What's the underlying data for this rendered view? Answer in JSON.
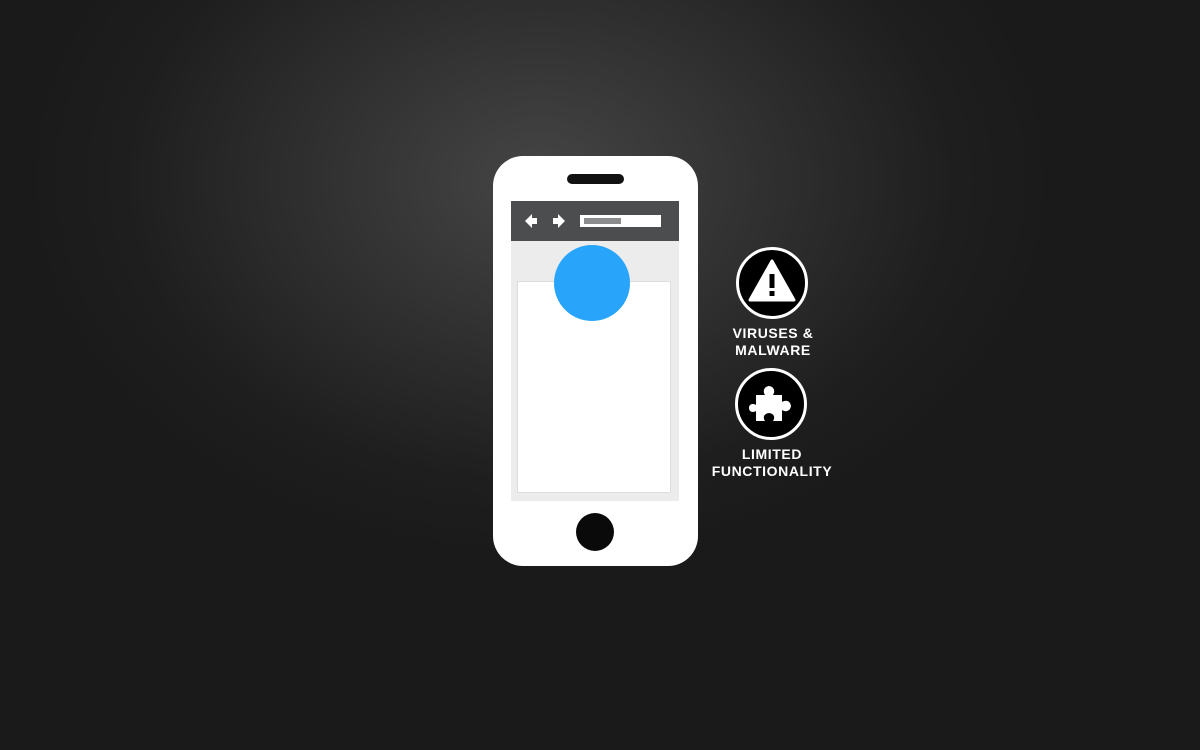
{
  "background_color": "#1e1e1e",
  "phone": {
    "body_color": "#ffffff",
    "browser_bar_color": "#4b4d4f",
    "content_circle_color": "#28a5fb",
    "address_bar_progress": 0.5,
    "icons": {
      "back": "arrow-left-icon",
      "forward": "arrow-right-icon"
    }
  },
  "warnings": [
    {
      "icon": "warning-triangle-icon",
      "label_line1": "VIRUSES &",
      "label_line2": "MALWARE"
    },
    {
      "icon": "puzzle-piece-icon",
      "label_line1": "LIMITED",
      "label_line2": "FUNCTIONALITY"
    }
  ]
}
